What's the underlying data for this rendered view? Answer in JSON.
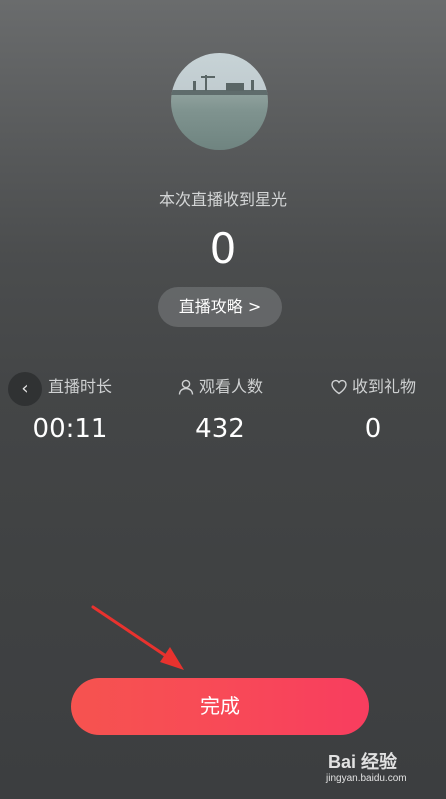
{
  "summary": {
    "subtitle": "本次直播收到星光",
    "star_count": "0",
    "guide_button": "直播攻略 >"
  },
  "navigation": {
    "back_icon": "chevron-left-icon",
    "back_glyph": "‹"
  },
  "stats": [
    {
      "icon": "clock-icon",
      "label": "直播时长",
      "value": "00:11"
    },
    {
      "icon": "person-icon",
      "label": "观看人数",
      "value": "432"
    },
    {
      "icon": "heart-icon",
      "label": "收到礼物",
      "value": "0"
    }
  ],
  "actions": {
    "done_button": "完成"
  },
  "watermark": {
    "brand": "Bai 经验",
    "url": "jingyan.baidu.com"
  },
  "colors": {
    "done_button": "#f84a57",
    "annotation_arrow": "#e8322e"
  }
}
